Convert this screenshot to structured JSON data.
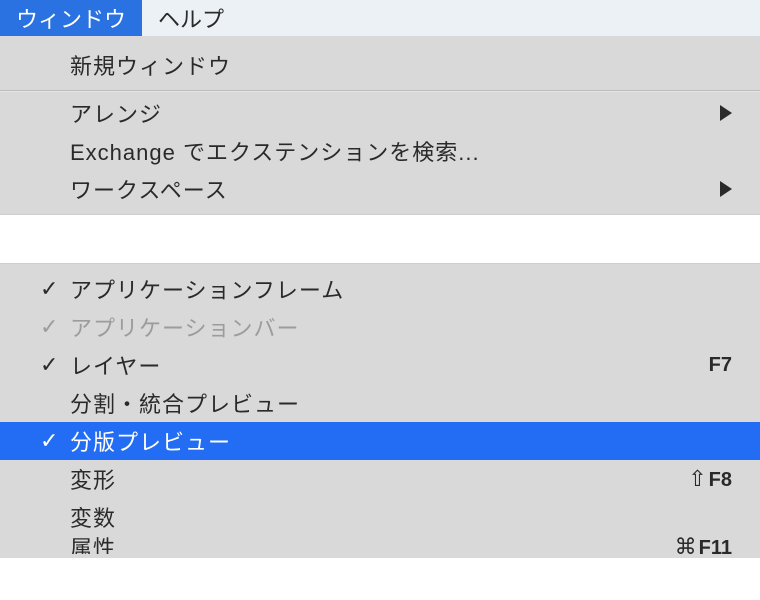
{
  "menubar": {
    "window": "ウィンドウ",
    "help": "ヘルプ"
  },
  "top_group": {
    "new_window": "新規ウィンドウ",
    "arrange": "アレンジ",
    "exchange": "Exchange でエクステンションを検索...",
    "workspace": "ワークスペース"
  },
  "bottom_group": {
    "app_frame": "アプリケーションフレーム",
    "app_bar": "アプリケーションバー",
    "layers": "レイヤー",
    "layers_shortcut": "F7",
    "flatten_preview": "分割・統合プレビュー",
    "separations_preview": "分版プレビュー",
    "transform": "変形",
    "transform_shortcut": "F8",
    "variables": "変数",
    "attributes": "属性",
    "attributes_shortcut_partial": "F11"
  },
  "glyphs": {
    "check": "✓",
    "shift": "⇧",
    "command": "⌘"
  }
}
